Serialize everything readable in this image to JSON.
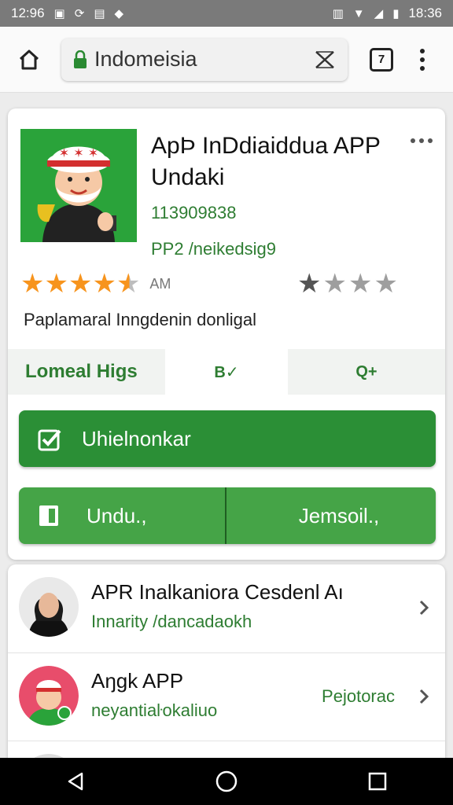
{
  "status_bar": {
    "time_left": "12:96",
    "time_right": "18:36"
  },
  "browser": {
    "url_text": "Indomeisia",
    "tab_count": "7"
  },
  "app": {
    "title": "ApÞ InDdiaiddua APP Undaki",
    "number": "113909838",
    "subtitle": "PP2 /neikedsig9",
    "rating_label": "AM",
    "rating_left": 4.5,
    "rating_right": 1,
    "description": "Paplamaral Inngdenin donligal",
    "action_left": "Lomeal Higs",
    "action_mid_icon": "B✓",
    "action_right_icon": "Q+",
    "primary_button": "Uhielnonkar",
    "split_left": "Undu.,",
    "split_right": "Jemsoil.,"
  },
  "list": [
    {
      "title": "APR Inalkaniora Cesdenl Aı",
      "subtitle": "Innarity /dancadaokh",
      "status": ""
    },
    {
      "title": "Aŋgk APP",
      "subtitle": "neyantiaŀokaliuo",
      "status": "Pejotorac"
    }
  ],
  "colors": {
    "accent_green": "#2b8f36",
    "star_orange": "#f7941d"
  },
  "icons": {
    "home": "home-icon",
    "lock": "lock-icon",
    "close": "close-icon",
    "tabs": "tabs-icon",
    "menu": "overflow-menu-icon",
    "back": "back-icon",
    "recents": "recents-icon"
  }
}
